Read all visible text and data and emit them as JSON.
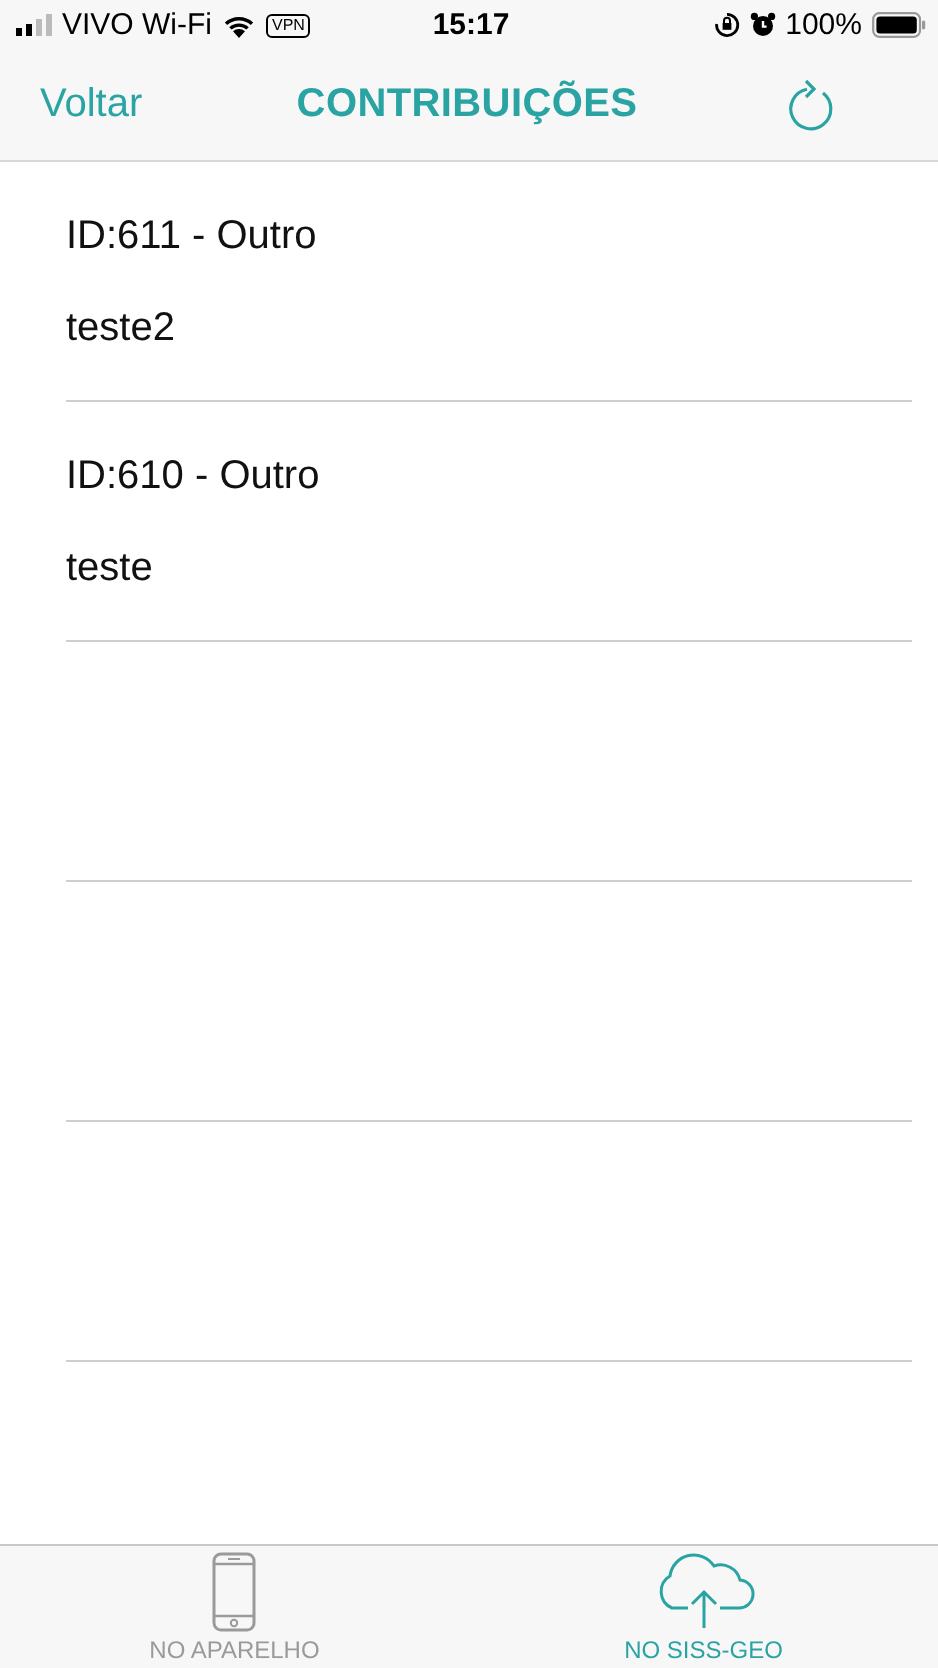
{
  "status_bar": {
    "carrier": "VIVO Wi-Fi",
    "vpn": "VPN",
    "time": "15:17",
    "battery": "100%"
  },
  "nav": {
    "back": "Voltar",
    "title": "CONTRIBUIÇÕES"
  },
  "items": [
    {
      "title": "ID:611 - Outro",
      "subtitle": "teste2"
    },
    {
      "title": "ID:610 - Outro",
      "subtitle": "teste"
    }
  ],
  "tabs": [
    {
      "label": "NO APARELHO",
      "kind": "phone",
      "selected": false
    },
    {
      "label": "NO SISS-GEO",
      "kind": "cloud",
      "selected": true
    }
  ]
}
